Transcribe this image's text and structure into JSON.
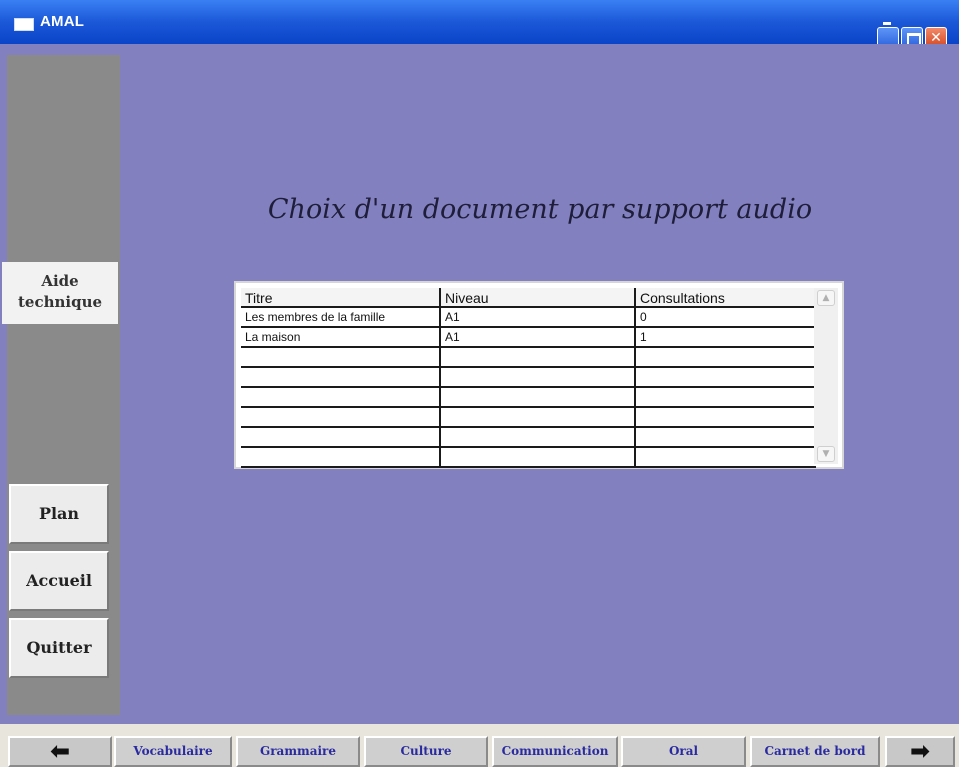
{
  "window": {
    "title": "AMAL"
  },
  "sidebar": {
    "aide_line1": "Aide",
    "aide_line2": "technique",
    "plan": "Plan",
    "accueil": "Accueil",
    "quitter": "Quitter"
  },
  "page_title": "Choix d'un document par support audio",
  "grid": {
    "columns": [
      "Titre",
      "Niveau",
      "Consultations"
    ],
    "rows": [
      [
        "Les membres de la famille",
        "A1",
        "0"
      ],
      [
        "La maison",
        "A1",
        "1"
      ]
    ]
  },
  "tabs": [
    "Vocabulaire",
    "Grammaire",
    "Culture",
    "Communication",
    "Oral",
    "Carnet de bord"
  ],
  "nav": {
    "back_icon": "arrow-left-icon",
    "forward_icon": "arrow-right-icon"
  },
  "colors": {
    "background": "#8380c0",
    "sidebar": "#8a8a8a",
    "tab_text": "#2a2aa0"
  }
}
